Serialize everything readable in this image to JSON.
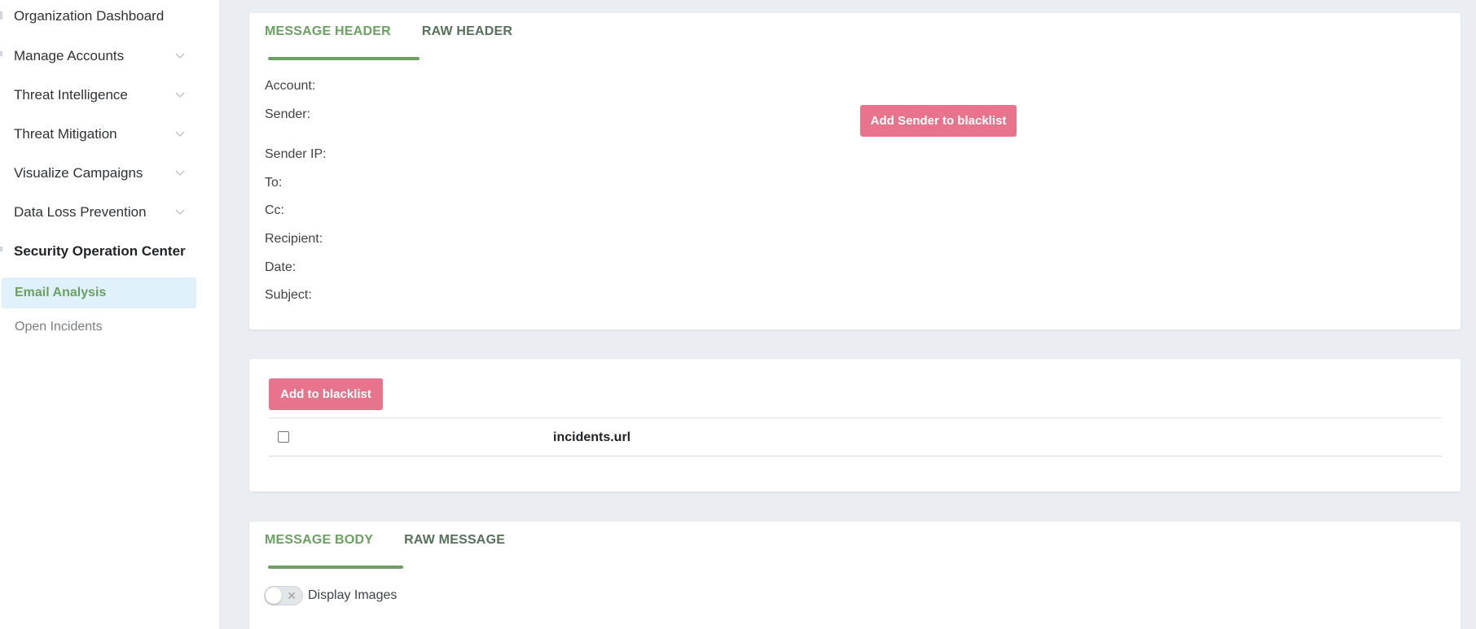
{
  "sidebar": {
    "items": [
      {
        "label": "Organization Dashboard"
      },
      {
        "label": "Manage Accounts"
      },
      {
        "label": "Threat Intelligence"
      },
      {
        "label": "Threat Mitigation"
      },
      {
        "label": "Visualize Campaigns"
      },
      {
        "label": "Data Loss Prevention"
      },
      {
        "label": "Security Operation Center"
      }
    ],
    "sub_items": [
      {
        "label": "Email Analysis"
      },
      {
        "label": "Open Incidents"
      }
    ]
  },
  "header_card": {
    "tabs": [
      "MESSAGE HEADER",
      "RAW HEADER"
    ],
    "fields": [
      "Account:",
      "Sender:",
      "Sender IP:",
      "To:",
      "Cc:",
      "Recipient:",
      "Date:",
      "Subject:"
    ],
    "blacklist_sender_button": "Add Sender to blacklist"
  },
  "url_card": {
    "add_button": "Add to blacklist",
    "column_header": "incidents.url"
  },
  "body_card": {
    "tabs": [
      "MESSAGE BODY",
      "RAW MESSAGE"
    ],
    "toggle_label": "Display Images",
    "toggle_on": false
  },
  "colors": {
    "accent_green": "#6aa160",
    "button_pink": "#e8738c",
    "active_bg": "#e1f1fc"
  },
  "icons": [
    "chevron-down-icon",
    "close-icon"
  ]
}
